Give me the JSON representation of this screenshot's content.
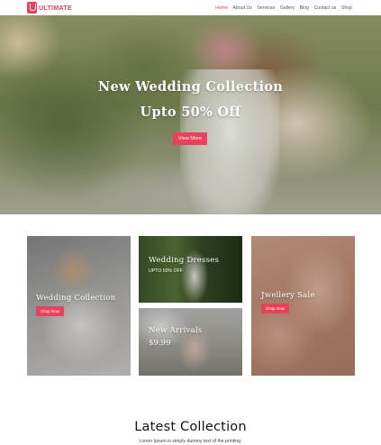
{
  "brand": {
    "name": "ULTIMATE",
    "logo_letter": "U"
  },
  "nav": {
    "items": [
      {
        "label": "Home",
        "active": true
      },
      {
        "label": "About Us",
        "active": false
      },
      {
        "label": "Services",
        "active": false
      },
      {
        "label": "Gallery",
        "active": false
      },
      {
        "label": "Blog",
        "active": false
      },
      {
        "label": "Contact us",
        "active": false
      },
      {
        "label": "Shop",
        "active": false
      }
    ]
  },
  "hero": {
    "title": "New Wedding Collection",
    "subtitle": "Upto 50% Off",
    "button_label": "View More"
  },
  "cards": {
    "wedding_collection": {
      "title": "Wedding Collection",
      "button_label": "Shop Now"
    },
    "wedding_dresses": {
      "title": "Wedding Dresses",
      "subtitle": "UPTO 50% OFF"
    },
    "new_arrivals": {
      "title": "New Arrivals",
      "price": "$9.99"
    },
    "jewellery_sale": {
      "title": "Jwellery Sale",
      "button_label": "Shop Now"
    }
  },
  "latest": {
    "title": "Latest Collection",
    "description": "Lorem Ipsum is simply dummy text of the printing."
  },
  "colors": {
    "accent": "#e8425a",
    "text": "#111111"
  }
}
